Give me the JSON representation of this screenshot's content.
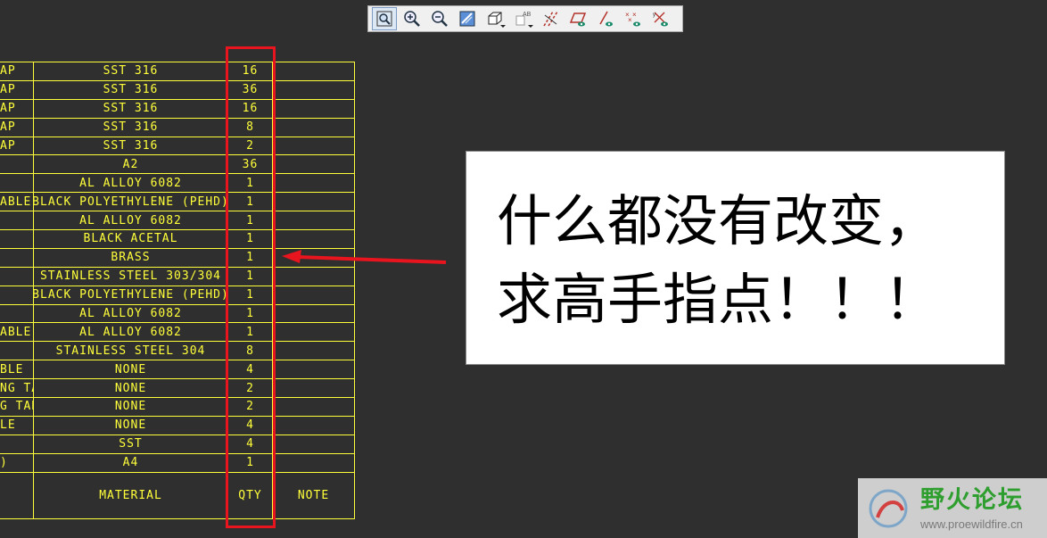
{
  "toolbar": {
    "buttons": [
      {
        "name": "zoom-window-icon"
      },
      {
        "name": "zoom-in-icon"
      },
      {
        "name": "zoom-out-icon"
      },
      {
        "name": "repaint-icon"
      },
      {
        "name": "display-style-icon",
        "dropdown": true
      },
      {
        "name": "annotation-display-icon",
        "dropdown": true
      },
      {
        "name": "datum-axes-icon"
      },
      {
        "name": "datum-planes-icon"
      },
      {
        "name": "datum-points-icon"
      },
      {
        "name": "point-display-icon"
      },
      {
        "name": "coordinate-systems-icon"
      }
    ]
  },
  "bom": {
    "rows": [
      {
        "desc": "AP",
        "material": "SST 316",
        "qty": "16"
      },
      {
        "desc": "AP",
        "material": "SST 316",
        "qty": "36"
      },
      {
        "desc": "AP",
        "material": "SST 316",
        "qty": "16"
      },
      {
        "desc": "AP",
        "material": "SST 316",
        "qty": "8"
      },
      {
        "desc": "AP",
        "material": "SST 316",
        "qty": "2"
      },
      {
        "desc": "",
        "material": "A2",
        "qty": "36"
      },
      {
        "desc": "",
        "material": "AL ALLOY 6082",
        "qty": "1"
      },
      {
        "desc": "ABLE",
        "material": "BLACK POLYETHYLENE (PEHD)",
        "qty": "1"
      },
      {
        "desc": "",
        "material": "AL ALLOY 6082",
        "qty": "1"
      },
      {
        "desc": "",
        "material": "BLACK ACETAL",
        "qty": "1"
      },
      {
        "desc": "",
        "material": "BRASS",
        "qty": "1"
      },
      {
        "desc": "",
        "material": "STAINLESS STEEL 303/304",
        "qty": "1"
      },
      {
        "desc": "",
        "material": "BLACK POLYETHYLENE (PEHD)",
        "qty": "1"
      },
      {
        "desc": "",
        "material": "AL ALLOY 6082",
        "qty": "1"
      },
      {
        "desc": "ABLE",
        "material": "AL ALLOY 6082",
        "qty": "1"
      },
      {
        "desc": "",
        "material": "STAINLESS STEEL 304",
        "qty": "8"
      },
      {
        "desc": "BLE",
        "material": "NONE",
        "qty": "4"
      },
      {
        "desc": "NG TABLE",
        "material": "NONE",
        "qty": "2"
      },
      {
        "desc": "G TABLE",
        "material": "NONE",
        "qty": "2"
      },
      {
        "desc": "LE",
        "material": "NONE",
        "qty": "4"
      },
      {
        "desc": "",
        "material": "SST",
        "qty": "4"
      },
      {
        "desc": ")",
        "material": "A4",
        "qty": "1"
      }
    ],
    "header": {
      "material": "MATERIAL",
      "qty": "QTY",
      "note": "NOTE"
    }
  },
  "callout": {
    "line1": "什么都没有改变，",
    "line2": "求高手指点！！！"
  },
  "watermark": {
    "title": "野火论坛",
    "url": "www.proewildfire.cn"
  },
  "colors": {
    "background": "#2f2f2f",
    "table_lines": "#ffff3a",
    "highlight": "#e8141e",
    "watermark_green": "#2e9e2e"
  }
}
